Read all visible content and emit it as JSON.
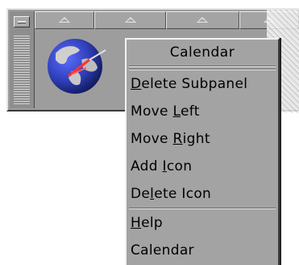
{
  "menu": {
    "title": "Calendar",
    "items": [
      {
        "pre": "",
        "ul": "D",
        "post": "elete Subpanel"
      },
      {
        "pre": "Move ",
        "ul": "L",
        "post": "eft"
      },
      {
        "pre": "Move ",
        "ul": "R",
        "post": "ight"
      },
      {
        "pre": "Add ",
        "ul": "I",
        "post": "con"
      },
      {
        "pre": "De",
        "ul": "l",
        "post": "ete Icon"
      },
      {
        "pre": "",
        "ul": "H",
        "post": "elp"
      },
      {
        "pre": "",
        "ul": "",
        "post": "Calendar"
      }
    ]
  },
  "panel": {
    "arrow_tabs": [
      "up-arrow-icon",
      "up-arrow-icon",
      "up-arrow-icon",
      "up-arrow-icon"
    ],
    "icon": "globe-icon"
  },
  "colors": {
    "panel_bg": "#9d9d9d",
    "menu_bg": "#a3a3a3",
    "globe_blue": "#2f3fb8"
  }
}
